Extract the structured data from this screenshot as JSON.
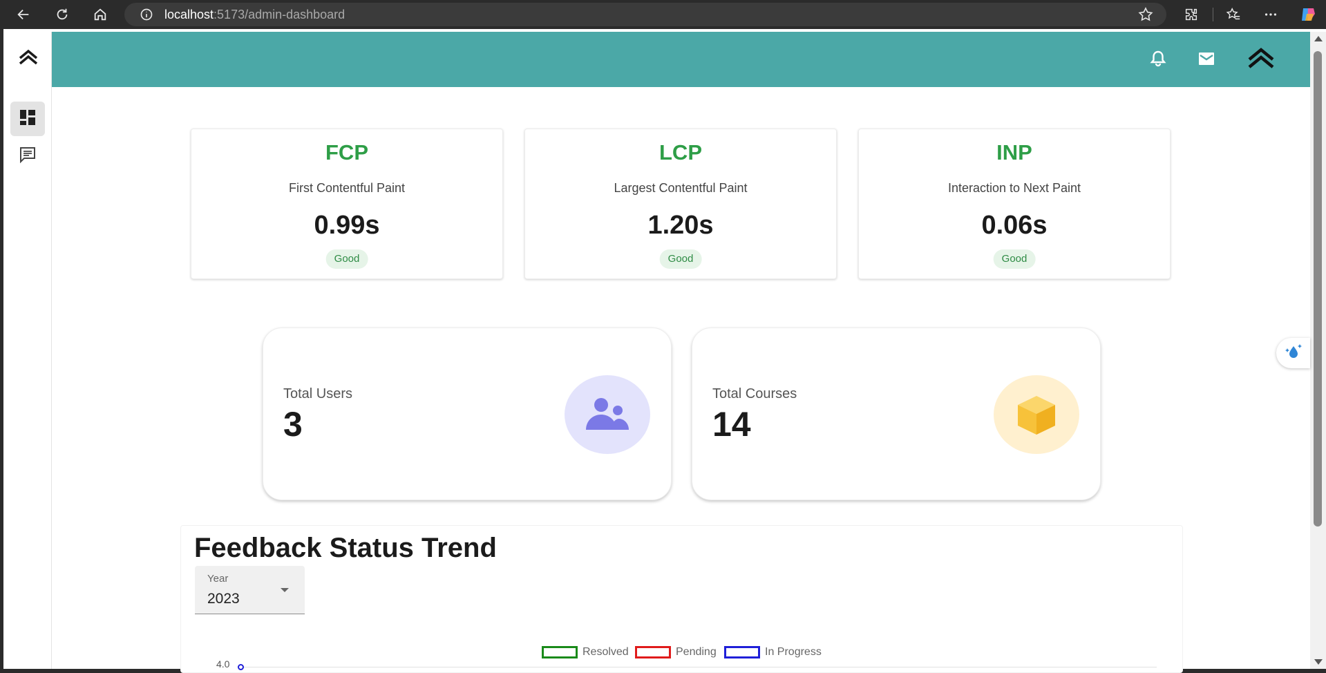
{
  "browser": {
    "url_host": "localhost",
    "url_path": ":5173/admin-dashboard"
  },
  "metrics": [
    {
      "abbr": "FCP",
      "name": "First Contentful Paint",
      "value": "0.99s",
      "status": "Good"
    },
    {
      "abbr": "LCP",
      "name": "Largest Contentful Paint",
      "value": "1.20s",
      "status": "Good"
    },
    {
      "abbr": "INP",
      "name": "Interaction to Next Paint",
      "value": "0.06s",
      "status": "Good"
    }
  ],
  "stats": {
    "users": {
      "label": "Total Users",
      "value": "3",
      "icon": "users-icon"
    },
    "courses": {
      "label": "Total Courses",
      "value": "14",
      "icon": "box-icon"
    }
  },
  "feedback": {
    "title": "Feedback Status Trend",
    "year_label": "Year",
    "year_value": "2023"
  },
  "chart_data": {
    "type": "line",
    "series": [
      {
        "name": "Resolved",
        "color": "#1a8a1a"
      },
      {
        "name": "Pending",
        "color": "#e01b1b"
      },
      {
        "name": "In Progress",
        "color": "#1f1fd8"
      }
    ],
    "y_ticks": [
      "4.0"
    ]
  },
  "colors": {
    "header": "#4ba8a7",
    "metric_green": "#2e9e47",
    "users_circle": "#e3e3fc",
    "courses_circle": "#fff0cf"
  }
}
